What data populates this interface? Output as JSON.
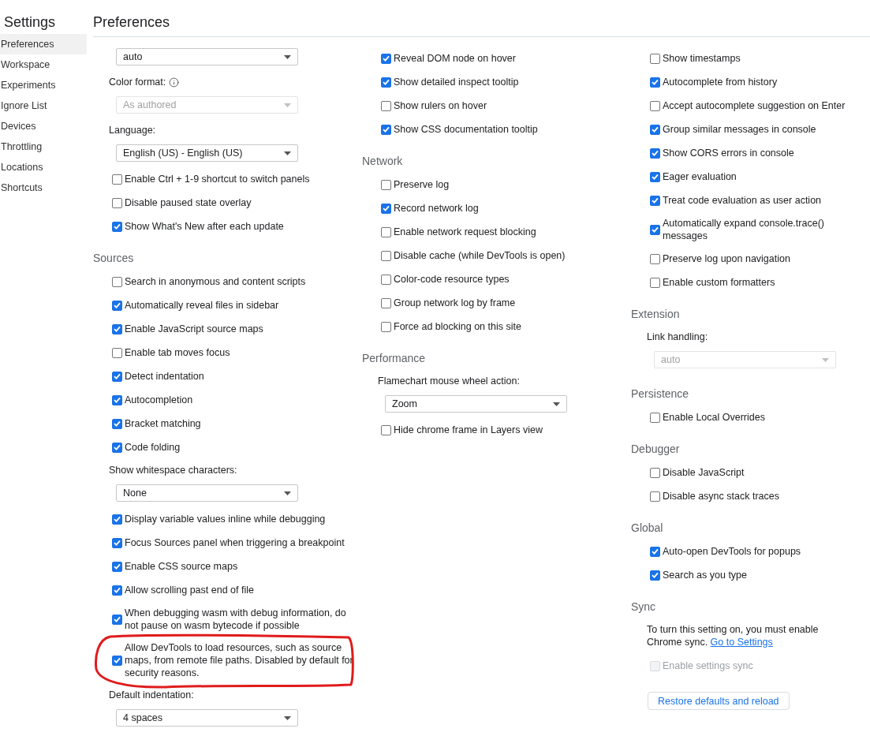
{
  "app_title": "Settings",
  "page_title": "Preferences",
  "sidebar": [
    {
      "label": "Preferences",
      "selected": true
    },
    {
      "label": "Workspace",
      "selected": false
    },
    {
      "label": "Experiments",
      "selected": false
    },
    {
      "label": "Ignore List",
      "selected": false
    },
    {
      "label": "Devices",
      "selected": false
    },
    {
      "label": "Throttling",
      "selected": false
    },
    {
      "label": "Locations",
      "selected": false
    },
    {
      "label": "Shortcuts",
      "selected": false
    }
  ],
  "columns": [
    [
      {
        "kind": "select",
        "value": "auto",
        "disabled": false
      },
      {
        "kind": "select",
        "label": "Color format:",
        "info": true,
        "value": "As authored",
        "disabled": true
      },
      {
        "kind": "select",
        "label": "Language:",
        "value": "English (US) - English (US)",
        "disabled": false
      },
      {
        "kind": "checkbox",
        "label": "Enable Ctrl + 1-9 shortcut to switch panels",
        "checked": false,
        "disabled": false
      },
      {
        "kind": "checkbox",
        "label": "Disable paused state overlay",
        "checked": false,
        "disabled": false
      },
      {
        "kind": "checkbox",
        "label": "Show What's New after each update",
        "checked": true,
        "disabled": false
      },
      {
        "kind": "heading",
        "label": "Sources"
      },
      {
        "kind": "checkbox",
        "label": "Search in anonymous and content scripts",
        "checked": false,
        "disabled": false
      },
      {
        "kind": "checkbox",
        "label": "Automatically reveal files in sidebar",
        "checked": true,
        "disabled": false
      },
      {
        "kind": "checkbox",
        "label": "Enable JavaScript source maps",
        "checked": true,
        "disabled": false
      },
      {
        "kind": "checkbox",
        "label": "Enable tab moves focus",
        "checked": false,
        "disabled": false
      },
      {
        "kind": "checkbox",
        "label": "Detect indentation",
        "checked": true,
        "disabled": false
      },
      {
        "kind": "checkbox",
        "label": "Autocompletion",
        "checked": true,
        "disabled": false
      },
      {
        "kind": "checkbox",
        "label": "Bracket matching",
        "checked": true,
        "disabled": false
      },
      {
        "kind": "checkbox",
        "label": "Code folding",
        "checked": true,
        "disabled": false
      },
      {
        "kind": "select",
        "label": "Show whitespace characters:",
        "value": "None",
        "disabled": false
      },
      {
        "kind": "checkbox",
        "label": "Display variable values inline while debugging",
        "checked": true,
        "disabled": false
      },
      {
        "kind": "checkbox",
        "label": "Focus Sources panel when triggering a breakpoint",
        "checked": true,
        "disabled": false
      },
      {
        "kind": "checkbox",
        "label": "Enable CSS source maps",
        "checked": true,
        "disabled": false
      },
      {
        "kind": "checkbox",
        "label": "Allow scrolling past end of file",
        "checked": true,
        "disabled": false
      },
      {
        "kind": "checkbox",
        "label": "When debugging wasm with debug information, do not pause on wasm bytecode if possible",
        "checked": true,
        "disabled": false
      },
      {
        "kind": "checkbox",
        "label": "Allow DevTools to load resources, such as source maps, from remote file paths. Disabled by default for security reasons.",
        "checked": true,
        "disabled": false,
        "circled": true
      },
      {
        "kind": "select",
        "label": "Default indentation:",
        "value": "4 spaces",
        "disabled": false
      }
    ],
    [
      {
        "kind": "checkbox",
        "label": "Reveal DOM node on hover",
        "checked": true,
        "disabled": false
      },
      {
        "kind": "checkbox",
        "label": "Show detailed inspect tooltip",
        "checked": true,
        "disabled": false
      },
      {
        "kind": "checkbox",
        "label": "Show rulers on hover",
        "checked": false,
        "disabled": false
      },
      {
        "kind": "checkbox",
        "label": "Show CSS documentation tooltip",
        "checked": true,
        "disabled": false
      },
      {
        "kind": "heading",
        "label": "Network"
      },
      {
        "kind": "checkbox",
        "label": "Preserve log",
        "checked": false,
        "disabled": false
      },
      {
        "kind": "checkbox",
        "label": "Record network log",
        "checked": true,
        "disabled": false
      },
      {
        "kind": "checkbox",
        "label": "Enable network request blocking",
        "checked": false,
        "disabled": false
      },
      {
        "kind": "checkbox",
        "label": "Disable cache (while DevTools is open)",
        "checked": false,
        "disabled": false
      },
      {
        "kind": "checkbox",
        "label": "Color-code resource types",
        "checked": false,
        "disabled": false
      },
      {
        "kind": "checkbox",
        "label": "Group network log by frame",
        "checked": false,
        "disabled": false
      },
      {
        "kind": "checkbox",
        "label": "Force ad blocking on this site",
        "checked": false,
        "disabled": false
      },
      {
        "kind": "heading",
        "label": "Performance"
      },
      {
        "kind": "select",
        "label": "Flamechart mouse wheel action:",
        "value": "Zoom",
        "disabled": false
      },
      {
        "kind": "checkbox",
        "label": "Hide chrome frame in Layers view",
        "checked": false,
        "disabled": false
      }
    ],
    [
      {
        "kind": "checkbox",
        "label": "Show timestamps",
        "checked": false,
        "disabled": false
      },
      {
        "kind": "checkbox",
        "label": "Autocomplete from history",
        "checked": true,
        "disabled": false
      },
      {
        "kind": "checkbox",
        "label": "Accept autocomplete suggestion on Enter",
        "checked": false,
        "disabled": false
      },
      {
        "kind": "checkbox",
        "label": "Group similar messages in console",
        "checked": true,
        "disabled": false
      },
      {
        "kind": "checkbox",
        "label": "Show CORS errors in console",
        "checked": true,
        "disabled": false
      },
      {
        "kind": "checkbox",
        "label": "Eager evaluation",
        "checked": true,
        "disabled": false
      },
      {
        "kind": "checkbox",
        "label": "Treat code evaluation as user action",
        "checked": true,
        "disabled": false
      },
      {
        "kind": "checkbox",
        "label": "Automatically expand console.trace() messages",
        "checked": true,
        "disabled": false
      },
      {
        "kind": "checkbox",
        "label": "Preserve log upon navigation",
        "checked": false,
        "disabled": false
      },
      {
        "kind": "checkbox",
        "label": "Enable custom formatters",
        "checked": false,
        "disabled": false
      },
      {
        "kind": "heading",
        "label": "Extension"
      },
      {
        "kind": "select",
        "label": "Link handling:",
        "value": "auto",
        "disabled": true
      },
      {
        "kind": "heading",
        "label": "Persistence"
      },
      {
        "kind": "checkbox",
        "label": "Enable Local Overrides",
        "checked": false,
        "disabled": false
      },
      {
        "kind": "heading",
        "label": "Debugger"
      },
      {
        "kind": "checkbox",
        "label": "Disable JavaScript",
        "checked": false,
        "disabled": false
      },
      {
        "kind": "checkbox",
        "label": "Disable async stack traces",
        "checked": false,
        "disabled": false
      },
      {
        "kind": "heading",
        "label": "Global"
      },
      {
        "kind": "checkbox",
        "label": "Auto-open DevTools for popups",
        "checked": true,
        "disabled": false
      },
      {
        "kind": "checkbox",
        "label": "Search as you type",
        "checked": true,
        "disabled": false
      },
      {
        "kind": "heading",
        "label": "Sync"
      },
      {
        "kind": "note",
        "text": "To turn this setting on, you must enable Chrome sync.",
        "link": "Go to Settings"
      },
      {
        "kind": "checkbox",
        "label": "Enable settings sync",
        "checked": false,
        "disabled": true
      },
      {
        "kind": "button",
        "label": "Restore defaults and reload"
      }
    ]
  ]
}
